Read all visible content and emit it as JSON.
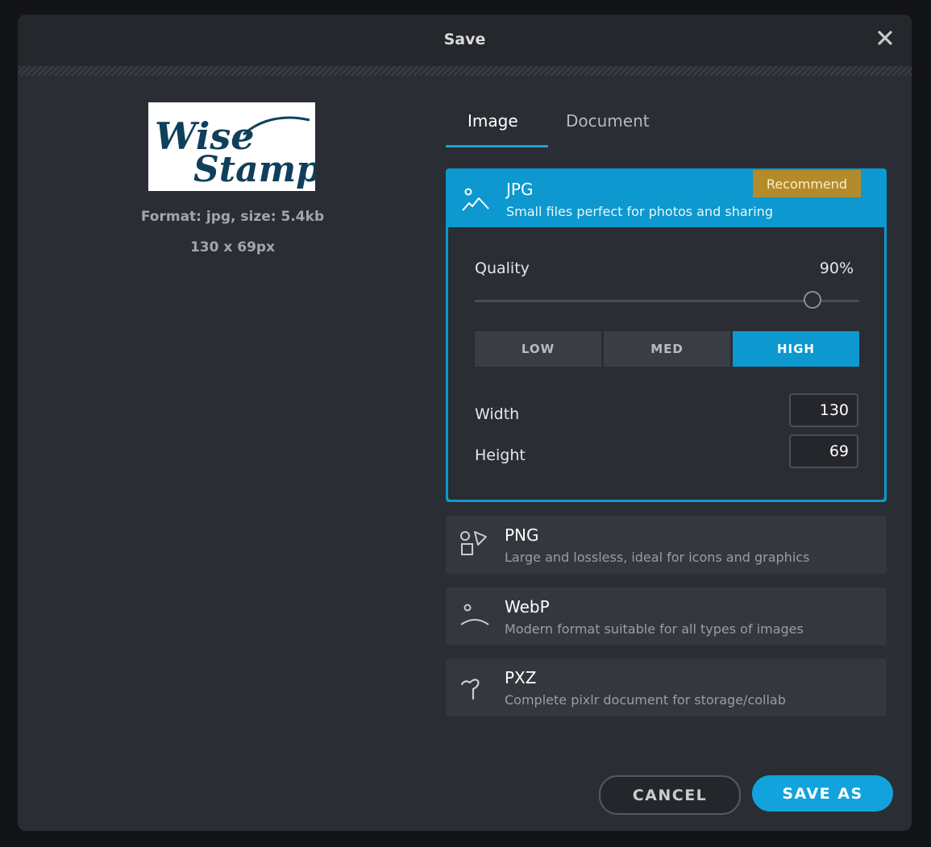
{
  "dialog": {
    "title": "Save"
  },
  "preview": {
    "logo_line1": "Wise",
    "logo_line2": "Stamp",
    "format_info": "Format: jpg, size: 5.4kb",
    "dimensions": "130 x 69px"
  },
  "tabs": [
    {
      "label": "Image",
      "active": true
    },
    {
      "label": "Document",
      "active": false
    }
  ],
  "formats": [
    {
      "name": "JPG",
      "description": "Small files perfect for photos and sharing",
      "badge": "Recommend",
      "selected": true,
      "icon": "landscape-icon"
    },
    {
      "name": "PNG",
      "description": "Large and lossless, ideal for icons and graphics",
      "selected": false,
      "icon": "shapes-icon"
    },
    {
      "name": "WebP",
      "description": "Modern format suitable for all types of images",
      "selected": false,
      "icon": "arc-icon"
    },
    {
      "name": "PXZ",
      "description": "Complete pixlr document for storage/collab",
      "selected": false,
      "icon": "pin-icon"
    }
  ],
  "jpg_options": {
    "quality_label": "Quality",
    "quality_value": "90%",
    "quality_fraction": 0.9,
    "presets": [
      {
        "label": "LOW",
        "active": false
      },
      {
        "label": "MED",
        "active": false
      },
      {
        "label": "HIGH",
        "active": true
      }
    ],
    "width_label": "Width",
    "width_value": "130",
    "height_label": "Height",
    "height_value": "69"
  },
  "footer": {
    "cancel_label": "CANCEL",
    "save_as_label": "SAVE AS"
  },
  "colors": {
    "accent": "#0d98cf",
    "badge": "#b48b2a",
    "panel": "#2a2d33",
    "logo": "#0f3f5a"
  }
}
